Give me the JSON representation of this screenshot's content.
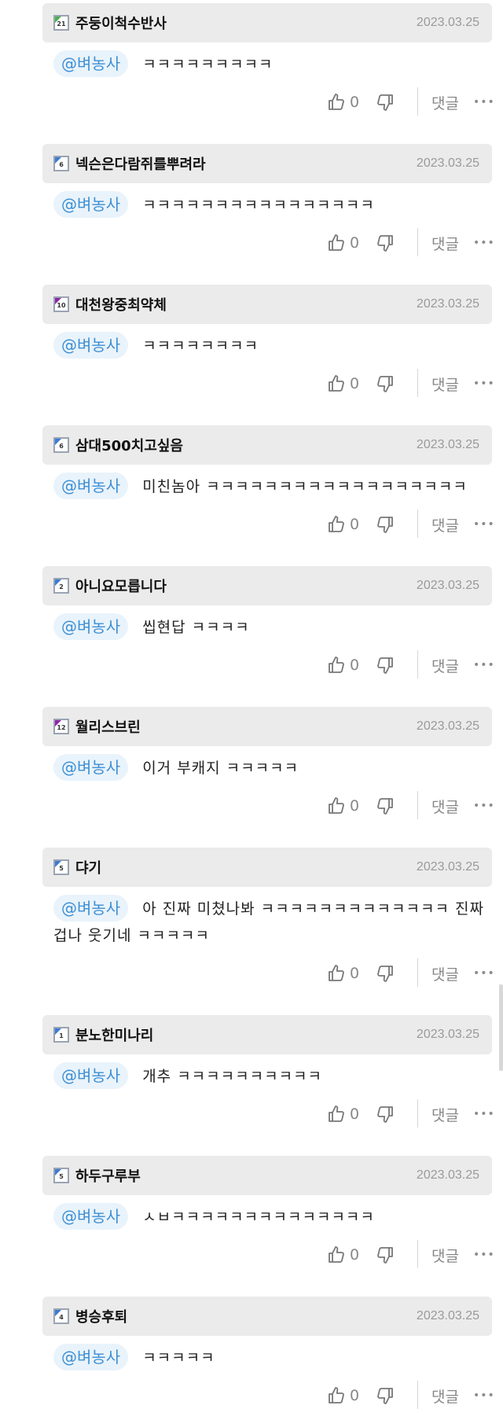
{
  "labels": {
    "reply": "댓글",
    "more": "•••"
  },
  "colors": {
    "mention_bg": "#e9f3fb",
    "mention_text": "#3d8fd3",
    "header_bg": "#ebebeb"
  },
  "comments": [
    {
      "level": "21",
      "level_color": "#4caf50",
      "nick": "주둥이척수반사",
      "date": "2023.03.25",
      "mention": "@벼농사",
      "text": "ㅋㅋㅋㅋㅋㅋㅋㅋㅋ",
      "likes": "0"
    },
    {
      "level": "6",
      "level_color": "#3a7bd5",
      "nick": "넥슨은다람쥐를뿌려라",
      "date": "2023.03.25",
      "mention": "@벼농사",
      "text": "ㅋㅋㅋㅋㅋㅋㅋㅋㅋㅋㅋㅋㅋㅋㅋㅋ",
      "likes": "0"
    },
    {
      "level": "10",
      "level_color": "#8e24aa",
      "nick": "대천왕중최약체",
      "date": "2023.03.25",
      "mention": "@벼농사",
      "text": "ㅋㅋㅋㅋㅋㅋㅋㅋ",
      "likes": "0"
    },
    {
      "level": "6",
      "level_color": "#3a7bd5",
      "nick": "삼대500치고싶음",
      "date": "2023.03.25",
      "mention": "@벼농사",
      "text": "미친놈아 ㅋㅋㅋㅋㅋㅋㅋㅋㅋㅋㅋㅋㅋㅋㅋㅋㅋㅋ",
      "likes": "0"
    },
    {
      "level": "2",
      "level_color": "#3a7bd5",
      "nick": "아니요모릅니다",
      "date": "2023.03.25",
      "mention": "@벼농사",
      "text": "씹현답 ㅋㅋㅋㅋ",
      "likes": "0"
    },
    {
      "level": "12",
      "level_color": "#8e24aa",
      "nick": "월리스브린",
      "date": "2023.03.25",
      "mention": "@벼농사",
      "text": "이거 부캐지 ㅋㅋㅋㅋㅋ",
      "likes": "0"
    },
    {
      "level": "5",
      "level_color": "#3a7bd5",
      "nick": "댜기",
      "date": "2023.03.25",
      "mention": "@벼농사",
      "text": "아 진짜 미쳤나봐 ㅋㅋㅋㅋㅋㅋㅋㅋㅋㅋㅋㅋㅋ 진짜 겁나 웃기네 ㅋㅋㅋㅋㅋ",
      "likes": "0",
      "wrap": true
    },
    {
      "level": "1",
      "level_color": "#3a7bd5",
      "nick": "분노한미나리",
      "date": "2023.03.25",
      "mention": "@벼농사",
      "text": "개추 ㅋㅋㅋㅋㅋㅋㅋㅋㅋㅋ",
      "likes": "0"
    },
    {
      "level": "5",
      "level_color": "#3a7bd5",
      "nick": "하두구루부",
      "date": "2023.03.25",
      "mention": "@벼농사",
      "text": "ㅅㅂㅋㅋㅋㅋㅋㅋㅋㅋㅋㅋㅋㅋㅋㅋ",
      "likes": "0"
    },
    {
      "level": "4",
      "level_color": "#3a7bd5",
      "nick": "병승후퇴",
      "date": "2023.03.25",
      "mention": "@벼농사",
      "text": "ㅋㅋㅋㅋㅋ",
      "likes": "0"
    }
  ]
}
